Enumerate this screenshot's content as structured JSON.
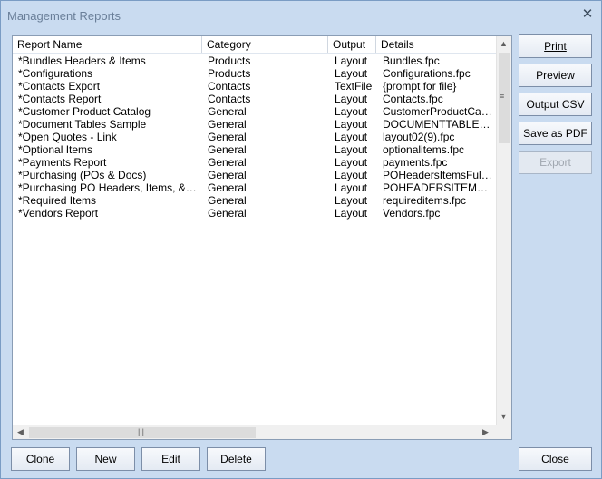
{
  "window": {
    "title": "Management Reports",
    "close_glyph": "✕"
  },
  "list": {
    "columns": [
      "Report Name",
      "Category",
      "Output",
      "Details"
    ],
    "rows": [
      [
        "*Bundles Headers & Items",
        "Products",
        "Layout",
        "Bundles.fpc"
      ],
      [
        "*Configurations",
        "Products",
        "Layout",
        "Configurations.fpc"
      ],
      [
        "*Contacts Export",
        "Contacts",
        "TextFile",
        "{prompt for file}"
      ],
      [
        "*Contacts Report",
        "Contacts",
        "Layout",
        "Contacts.fpc"
      ],
      [
        "*Customer Product Catalog",
        "General",
        "Layout",
        "CustomerProductCatal..."
      ],
      [
        "*Document Tables Sample",
        "General",
        "Layout",
        "DOCUMENTTABLES..."
      ],
      [
        "*Open Quotes - Link",
        "General",
        "Layout",
        "layout02(9).fpc"
      ],
      [
        "*Optional Items",
        "General",
        "Layout",
        "optionalitems.fpc"
      ],
      [
        "*Payments Report",
        "General",
        "Layout",
        "payments.fpc"
      ],
      [
        "*Purchasing (POs & Docs)",
        "General",
        "Layout",
        "POHeadersItemsFulfill..."
      ],
      [
        "*Purchasing PO Headers, Items, & Fulfill...",
        "General",
        "Layout",
        "POHEADERSITEMS..."
      ],
      [
        "*Required Items",
        "General",
        "Layout",
        "requireditems.fpc"
      ],
      [
        "*Vendors Report",
        "General",
        "Layout",
        "Vendors.fpc"
      ]
    ]
  },
  "side_buttons": {
    "print": {
      "label": "Print"
    },
    "preview": {
      "label": "Preview"
    },
    "output_csv": {
      "label": "Output CSV"
    },
    "save_pdf": {
      "label": "Save as PDF"
    },
    "export": {
      "label": "Export",
      "enabled": false
    }
  },
  "bottom_buttons": {
    "clone": {
      "label": "Clone"
    },
    "new": {
      "label": "New"
    },
    "edit": {
      "label": "Edit"
    },
    "delete": {
      "label": "Delete"
    },
    "close": {
      "label": "Close"
    }
  },
  "colors": {
    "frame_bg": "#c9dbf0",
    "border": "#7a9cc4",
    "list_bg": "#ffffff"
  }
}
